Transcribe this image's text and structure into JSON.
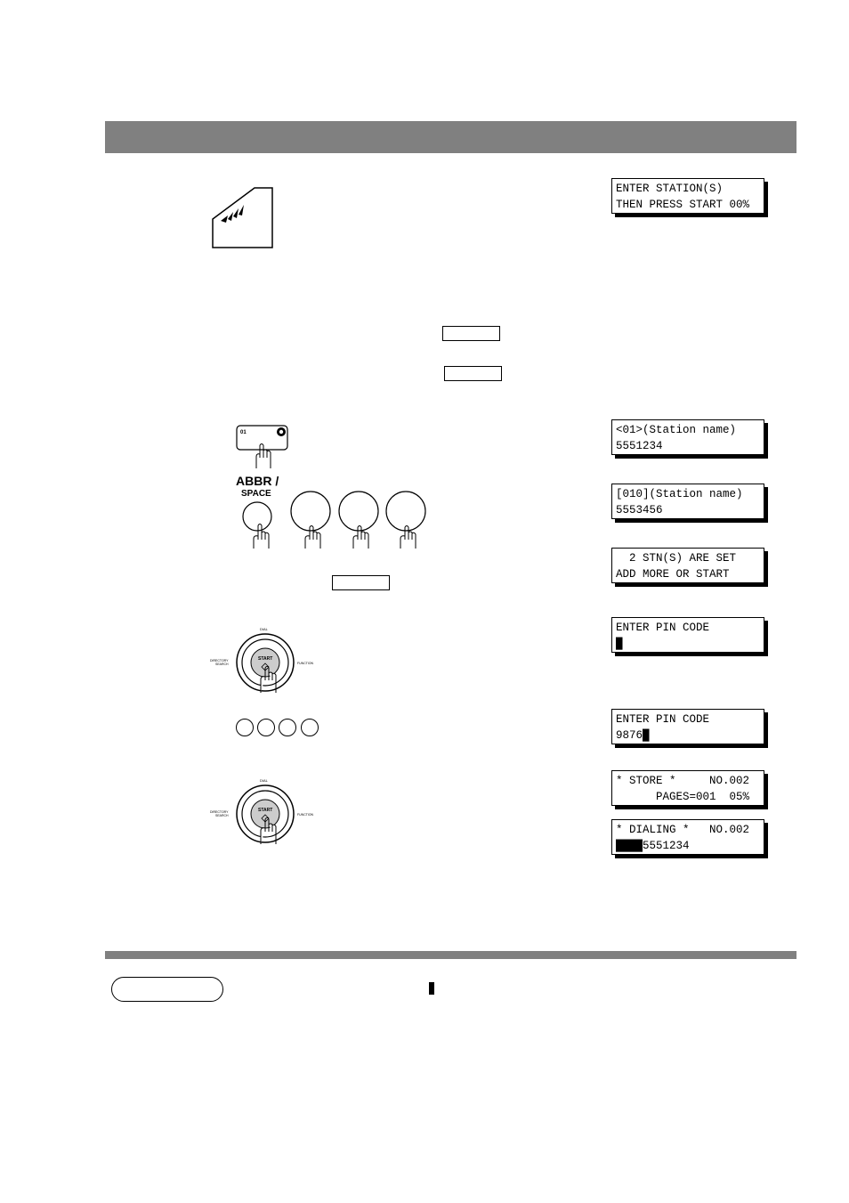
{
  "header": {
    "title": ""
  },
  "keys": {
    "one_touch_label": "01",
    "abbr_label_line1": "ABBR /",
    "abbr_label_line2": "SPACE",
    "start_label": "START",
    "dial_top": "DIAL",
    "dial_left_line1": "DIRECTORY",
    "dial_left_line2": "SEARCH",
    "dial_right": "FUNCTION"
  },
  "lcds": [
    {
      "line1": "ENTER STATION(S)",
      "line2": "THEN PRESS START 00%"
    },
    {
      "line1": "<01>(Station name)",
      "line2": "5551234"
    },
    {
      "line1": "[010](Station name)",
      "line2": "5553456"
    },
    {
      "line1": "  2 STN(S) ARE SET",
      "line2": "ADD MORE OR START"
    },
    {
      "line1": "ENTER PIN CODE",
      "line2": "█"
    },
    {
      "line1": "ENTER PIN CODE",
      "line2": "9876█"
    },
    {
      "line1": "* STORE *     NO.002",
      "line2": "      PAGES=001  05%"
    },
    {
      "line1": "* DIALING *   NO.002",
      "line2": "████5551234"
    }
  ],
  "note": {
    "label": ""
  }
}
